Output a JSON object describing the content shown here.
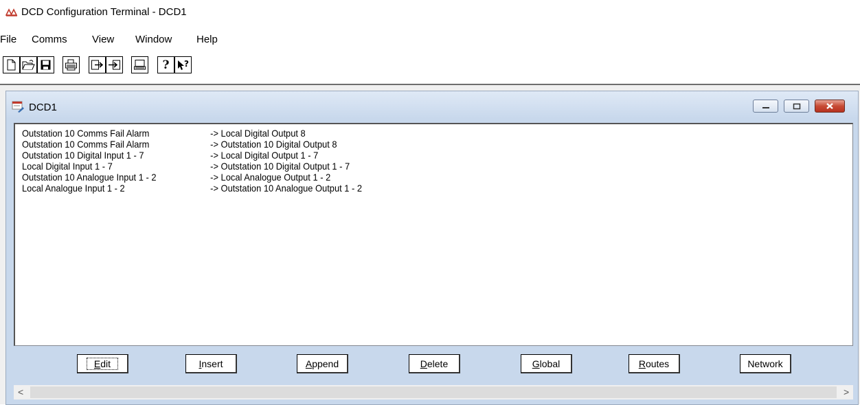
{
  "window": {
    "title": "DCD Configuration Terminal - DCD1"
  },
  "menu": [
    "File",
    "Comms",
    "View",
    "Window",
    "Help"
  ],
  "toolbar": {
    "icons": [
      "new-file-icon",
      "open-folder-icon",
      "save-icon",
      "print-icon",
      "upload-icon",
      "download-icon",
      "terminal-icon",
      "help-icon",
      "context-help-icon"
    ]
  },
  "child": {
    "title": "DCD1",
    "rows": [
      {
        "source": "Outstation 10 Comms Fail Alarm",
        "dest": "-> Local Digital Output 8"
      },
      {
        "source": "Outstation 10 Comms Fail Alarm",
        "dest": "-> Outstation 10 Digital Output 8"
      },
      {
        "source": "Outstation 10 Digital Input 1 - 7",
        "dest": "-> Local Digital Output 1 - 7"
      },
      {
        "source": "Local Digital Input 1 - 7",
        "dest": "-> Outstation 10 Digital Output 1 - 7"
      },
      {
        "source": "Outstation 10 Analogue Input 1 - 2",
        "dest": "-> Local Analogue Output 1 - 2"
      },
      {
        "source": "Local Analogue Input 1 - 2",
        "dest": "-> Outstation 10 Analogue Output 1 - 2"
      }
    ],
    "buttons": {
      "edit": {
        "u": "E",
        "rest": "dit"
      },
      "insert": {
        "u": "I",
        "rest": "nsert"
      },
      "append": {
        "u": "A",
        "rest": "ppend"
      },
      "delete": {
        "u": "D",
        "rest": "elete"
      },
      "global": {
        "u": "G",
        "rest": "lobal"
      },
      "routes": {
        "u": "R",
        "rest": "outes"
      },
      "network": {
        "u": "",
        "rest": "Network"
      }
    }
  },
  "scroll": {
    "left": "<",
    "right": ">"
  }
}
